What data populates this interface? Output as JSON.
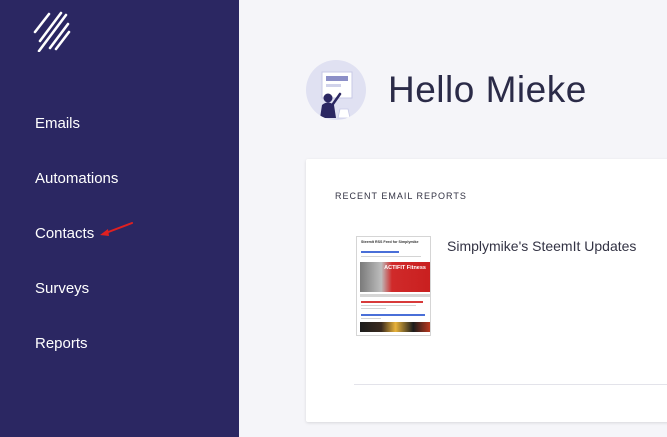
{
  "sidebar": {
    "logo_icon": "brand-slash-logo",
    "items": [
      {
        "label": "Emails"
      },
      {
        "label": "Automations"
      },
      {
        "label": "Contacts"
      },
      {
        "label": "Surveys"
      },
      {
        "label": "Reports"
      }
    ],
    "background": "#2b2762",
    "annotation_color": "#e02020"
  },
  "header": {
    "greeting": "Hello Mieke",
    "avatar_icon": "user-presenting-avatar"
  },
  "reports": {
    "title": "RECENT EMAIL REPORTS",
    "items": [
      {
        "name": "Simplymike's SteemIt Updates",
        "thumbnail": {
          "title": "SteemIt RSS Feed for Simplymike",
          "banner_text": "ACTIFIT Fitness"
        }
      }
    ]
  }
}
